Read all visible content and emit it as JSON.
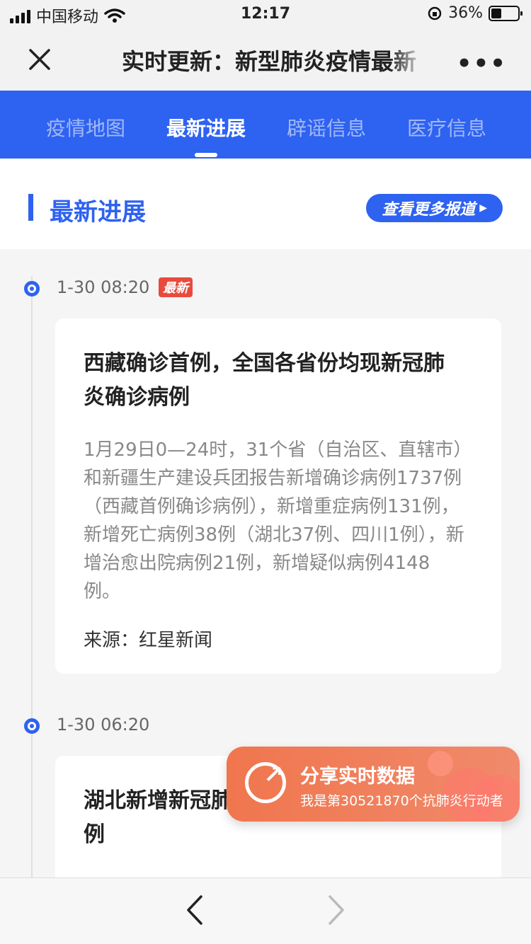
{
  "status_bar": {
    "carrier": "中国移动",
    "time": "12:17",
    "battery": "36%"
  },
  "navbar": {
    "title": "实时更新：新型肺炎疫情最新"
  },
  "tabs": [
    {
      "label": "疫情地图"
    },
    {
      "label": "最新进展"
    },
    {
      "label": "辟谣信息"
    },
    {
      "label": "医疗信息"
    }
  ],
  "section": {
    "title": "最新进展",
    "more_button": "查看更多报道"
  },
  "entries": [
    {
      "timestamp": "1-30 08:20",
      "badge": "最新",
      "title_line1": "西藏确诊首例，全国各省份均现新冠肺",
      "title_line2": "炎确诊病例",
      "body": "1月29日0—24时，31个省（自治区、直辖市）和新疆生产建设兵团报告新增确诊病例1737例（西藏首例确诊病例），新增重症病例131例，新增死亡病例38例（湖北37例、四川1例），新增治愈出院病例21例，新增疑似病例4148例。",
      "source": "来源：红星新闻"
    },
    {
      "timestamp": "1-30 06:20",
      "title_line1": "湖北新增新冠肺",
      "title_line2": "例"
    }
  ],
  "share": {
    "title": "分享实时数据",
    "subtitle": "我是第30521870个抗肺炎行动者"
  },
  "colors": {
    "brand_blue": "#2e62f0",
    "badge_red": "#e84a3d",
    "share_orange": "#f0764e"
  }
}
